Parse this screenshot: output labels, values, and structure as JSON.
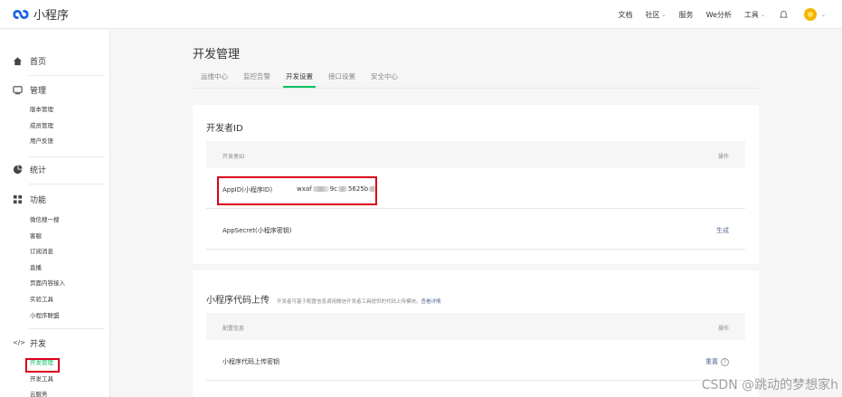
{
  "brand": {
    "name": "小程序",
    "logo_icon": "mini-program-logo-icon"
  },
  "topnav": {
    "items": [
      "文档",
      "社区",
      "服务",
      "We分析",
      "工具"
    ],
    "dropdown_flags": [
      false,
      true,
      false,
      false,
      true
    ]
  },
  "sidebar": {
    "home": "首页",
    "manage": "管理",
    "manage_items": [
      "版本管理",
      "成员管理",
      "用户反馈"
    ],
    "stats": "统计",
    "features": "功能",
    "feature_items": [
      "微信搜一搜",
      "客服",
      "订阅消息",
      "直播",
      "页面内容接入",
      "实验工具",
      "小程序联盟"
    ],
    "develop": "开发",
    "develop_items": [
      "开发管理",
      "开发工具",
      "云服务"
    ]
  },
  "page": {
    "title": "开发管理",
    "tabs": [
      "运维中心",
      "监控告警",
      "开发设置",
      "接口设置",
      "安全中心"
    ],
    "active_tab": "开发设置"
  },
  "developer_id": {
    "title": "开发者ID",
    "col_left": "开发者ID",
    "col_right": "操作",
    "appid_label": "AppID(小程序ID)",
    "appid_value_prefix": "wxaf",
    "appid_value_mid": "9c",
    "appid_value_suffix": "5625b",
    "secret_label": "AppSecret(小程序密钥)",
    "secret_action": "生成"
  },
  "upload": {
    "title": "小程序代码上传",
    "desc": "开发者可基于配置信息调用微信开发者工具提供的代码上传模块。",
    "desc_link": "查看详情",
    "col_left": "配置信息",
    "col_right": "操作",
    "row_label": "小程序代码上传密钥",
    "row_action": "重置"
  },
  "watermark": "CSDN @跳动的梦想家h",
  "colors": {
    "accent": "#07c160",
    "link": "#576b95",
    "highlight": "#d9001b"
  }
}
